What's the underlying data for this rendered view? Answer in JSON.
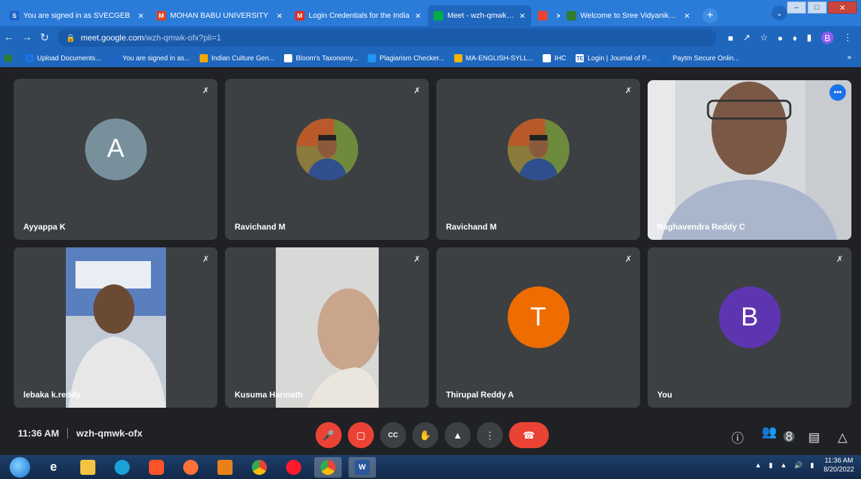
{
  "browser": {
    "tabs": [
      {
        "label": "You are signed in as SVECGEB",
        "fav_text": "S",
        "fav_color": "#1e63c8",
        "width": 212
      },
      {
        "label": "MOHAN BABU UNIVERSITY",
        "fav_text": "M",
        "fav_color": "#d8452b",
        "width": 200
      },
      {
        "label": "Login Credentials for the India",
        "fav_text": "M",
        "fav_color": "#d93025",
        "width": 200
      },
      {
        "label": "Meet - wzh-qmwk-ofx",
        "fav_text": "",
        "fav_color": "#00ac47",
        "width": 150,
        "active": true
      },
      {
        "label": "",
        "fav_text": "",
        "fav_color": "#ea4335",
        "width": 40
      },
      {
        "label": "Welcome to Sree Vidyanikethan",
        "fav_text": "",
        "fav_color": "#2e7d32",
        "width": 196
      }
    ],
    "url_host": "meet.google.com",
    "url_path": "/wzh-qmwk-ofx?pli=1",
    "profile_letter": "B",
    "bookmarks": [
      {
        "label": "Upload Documents...",
        "ic_color": "#1a73e8",
        "ic_text": "★"
      },
      {
        "label": "You are signed in as...",
        "ic_color": "#1e63c8",
        "ic_text": "S"
      },
      {
        "label": "Indian Culture Gen...",
        "ic_color": "#f2a900",
        "ic_text": ""
      },
      {
        "label": "Bloom's Taxonomy...",
        "ic_color": "#ffffff",
        "ic_text": ""
      },
      {
        "label": "Plagiarism Checker...",
        "ic_color": "#2196f3",
        "ic_text": ""
      },
      {
        "label": "MA-ENGLISH-SYLL...",
        "ic_color": "#f0b400",
        "ic_text": ""
      },
      {
        "label": "IHC",
        "ic_color": "#ffffff",
        "ic_text": ""
      },
      {
        "label": "Login | Journal of P...",
        "ic_color": "#ffffff",
        "ic_text": "TE"
      },
      {
        "label": "Paytm Secure Onlin...",
        "ic_color": "#1565c0",
        "ic_text": "P"
      }
    ]
  },
  "meet": {
    "time": "11:36 AM",
    "code": "wzh-qmwk-ofx",
    "participant_count": "8",
    "participants": [
      {
        "name": "Ayyappa K",
        "type": "letter",
        "letter": "A",
        "color": "#78909c"
      },
      {
        "name": "Ravichand M",
        "type": "photo"
      },
      {
        "name": "Ravichand M",
        "type": "photo"
      },
      {
        "name": "Raghavendra Reddy C",
        "type": "video"
      },
      {
        "name": "lebaka k.reddy",
        "type": "video"
      },
      {
        "name": "Kusuma Harinath",
        "type": "video"
      },
      {
        "name": "Thirupal Reddy A",
        "type": "letter",
        "letter": "T",
        "color": "#ef6c00"
      },
      {
        "name": "You",
        "type": "letter",
        "letter": "B",
        "color": "#5e35b1"
      }
    ]
  },
  "taskbar": {
    "clock_time": "11:36 AM",
    "clock_date": "8/20/2022"
  }
}
